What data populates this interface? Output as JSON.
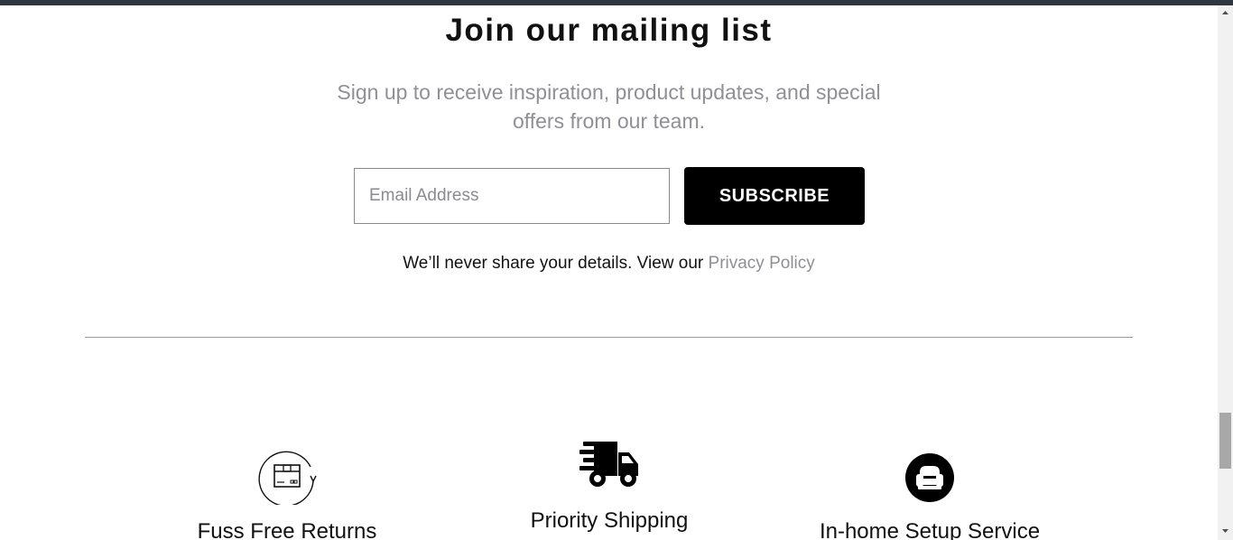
{
  "mailing": {
    "title": "Join our mailing list",
    "subtitle": "Sign up to receive inspiration, product updates, and special offers from our team.",
    "email_placeholder": "Email Address",
    "subscribe_label": "SUBSCRIBE",
    "privacy_text": "We’ll never share your details. View our",
    "privacy_link": "Privacy Policy"
  },
  "features": [
    {
      "label": "Fuss Free Returns",
      "icon": "box-return-icon"
    },
    {
      "label": "Priority Shipping",
      "icon": "delivery-truck-icon"
    },
    {
      "label": "In-home Setup Service",
      "icon": "armchair-icon"
    }
  ],
  "colors": {
    "top_bar": "#2f3541",
    "button": "#000000",
    "muted_text": "#8f8f95",
    "divider": "#9a9a9a"
  }
}
